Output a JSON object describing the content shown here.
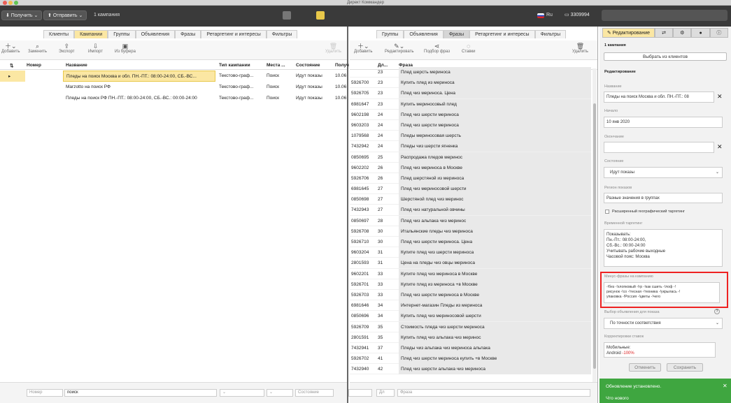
{
  "app": {
    "title": "Директ Коммандер"
  },
  "toolbar": {
    "get_label": "⬇ Получить ⌄",
    "send_label": "⬆ Отправить ⌄",
    "campaigns_count": "1 кампания",
    "balance": "3309994",
    "lang": "Ru"
  },
  "left": {
    "tabs": [
      "Клиенты",
      "Кампании",
      "Группы",
      "Объявления",
      "Фразы",
      "Ретаргетинг и интересы",
      "Фильтры"
    ],
    "active_tab": 1,
    "actions": [
      "Добавить",
      "Заменить",
      "Экспорт",
      "Импорт",
      "Из буфера"
    ],
    "delete_label": "Удалить",
    "columns": [
      "Номер",
      "Название",
      "Тип кампании",
      "Места ...",
      "Состояние",
      "Получ"
    ],
    "rows": [
      {
        "name": "Пледы на поиск Москва и обл. ПН.-ПТ.: 08:00-24:00, СБ.-ВС...",
        "type": "Текстово-граф...",
        "place": "Поиск",
        "state": "Идут показы",
        "extra": "10.06",
        "selected": true
      },
      {
        "name": "Marzotto на поиск РФ",
        "type": "Текстово-граф...",
        "place": "Поиск",
        "state": "Идут показы",
        "extra": "10.06",
        "selected": false
      },
      {
        "name": "Пледы на поиск РФ ПН.-ПТ.: 08:00-24:00, СБ.-ВС.: 00:00-24:00",
        "type": "Текстово-граф...",
        "place": "Поиск",
        "state": "Идут показы",
        "extra": "10.06",
        "selected": false
      }
    ],
    "filter_number_placeholder": "Номер",
    "filter_name_value": "поиск",
    "filter_state_placeholder": "Состояние"
  },
  "middle": {
    "tabs": [
      "Группы",
      "Объявления",
      "Фразы",
      "Ретаргетинг и интересы",
      "Фильтры"
    ],
    "active_tab": 2,
    "actions": [
      "Добавить",
      "Редактировать",
      "Подбор фраз",
      "Ставки"
    ],
    "delete_label": "Удалить",
    "columns": [
      "Дл...",
      "Фраза"
    ],
    "rows": [
      {
        "id": "",
        "len": "23",
        "phrase": "Плед шерсть мериноса"
      },
      {
        "id": "5926700",
        "len": "23",
        "phrase": "Купить плед из мериноса"
      },
      {
        "id": "5926705",
        "len": "23",
        "phrase": "Плед чиз мериноса. Цена"
      },
      {
        "id": "6981647",
        "len": "23",
        "phrase": "Купить мериносовый плед"
      },
      {
        "id": "9602198",
        "len": "24",
        "phrase": "Плед чиз шерсти мериноса"
      },
      {
        "id": "9603203",
        "len": "24",
        "phrase": "Плед чиз шерсти мериноса"
      },
      {
        "id": "1079568",
        "len": "24",
        "phrase": "Пледы мериносовая шерсть"
      },
      {
        "id": "7432942",
        "len": "24",
        "phrase": "Пледы чиз шерсти ягненка"
      },
      {
        "id": "0850695",
        "len": "25",
        "phrase": "Распродажа пледов меринос"
      },
      {
        "id": "9602202",
        "len": "26",
        "phrase": "Плед чиз мериноса в Москве"
      },
      {
        "id": "5926706",
        "len": "26",
        "phrase": "Плед шерстяной из мериноса"
      },
      {
        "id": "6981645",
        "len": "27",
        "phrase": "Плед чиз мериносовой шерсти"
      },
      {
        "id": "0850698",
        "len": "27",
        "phrase": "Шерстяной плед чиз меринос"
      },
      {
        "id": "7432943",
        "len": "27",
        "phrase": "Плед чиз натуральной овчины"
      },
      {
        "id": "0850697",
        "len": "28",
        "phrase": "Плед чиз альпака чиз меринос"
      },
      {
        "id": "5926708",
        "len": "30",
        "phrase": "Итальянские пледы чиз мериноса"
      },
      {
        "id": "5926710",
        "len": "30",
        "phrase": "Плед чиз шерсти мериноса. Цена"
      },
      {
        "id": "9603204",
        "len": "31",
        "phrase": "Купите плед чиз шерсти мериноса"
      },
      {
        "id": "2801593",
        "len": "31",
        "phrase": "Цена на пледы чиз овцы мериноса"
      },
      {
        "id": "9602201",
        "len": "33",
        "phrase": "Купите плед чиз мериноса в Москве"
      },
      {
        "id": "5926701",
        "len": "33",
        "phrase": "Купите плед из мериноса +в Москве"
      },
      {
        "id": "5926703",
        "len": "33",
        "phrase": "Плед чиз шерсти мериноса в Москве"
      },
      {
        "id": "6981646",
        "len": "34",
        "phrase": "Интернет-магазин Пледы из мериноса"
      },
      {
        "id": "0850696",
        "len": "34",
        "phrase": "Купить плед чиз мериносовой шерсти"
      },
      {
        "id": "5926709",
        "len": "35",
        "phrase": "Стоимость пледа чиз шерсти мериноса"
      },
      {
        "id": "2801591",
        "len": "35",
        "phrase": "Купить плед чиз альпака чиз меринос"
      },
      {
        "id": "7432941",
        "len": "37",
        "phrase": "Пледы чиз альпака чиз мериноса альпака"
      },
      {
        "id": "5926702",
        "len": "41",
        "phrase": "Плед чиз шерсти мериноса купить +в Москве"
      },
      {
        "id": "7432940",
        "len": "42",
        "phrase": "Плед чиз шерсти альпака чиз мериноса"
      }
    ],
    "filter_len_placeholder": "Дл",
    "filter_phrase_placeholder": "Фраза"
  },
  "right": {
    "edit_tab": "Редактирование",
    "campaigns_count": "1 кампания",
    "choose_client": "Выбрать из клиентов",
    "section": "Редактирование",
    "name_label": "Название",
    "name_value": "Пледы на поиск Москва и обл. ПН.-ПТ.: 08",
    "start_label": "Начало",
    "start_value": "10 янв 2020",
    "end_label": "Окончание",
    "state_label": "Состояние",
    "state_value": "Идут показы",
    "region_label": "Регион показов",
    "region_value": "Разные значения в группах",
    "geo_label": "Расширенный географический таргетинг",
    "time_label": "Временной таргетинг",
    "time_lines": [
      "Показывать:",
      "Пн.-Пт.: 08:00-24:00,",
      "Сб.-Вс.: 00:00-24:00",
      "Учитывать рабочие выходные",
      "Часовой пояс: Москва"
    ],
    "minus_label": "Минус-фразы на кампанию",
    "minus_lines": [
      "-!без -!хлопковый -!гр -!как сшить -!лоф -!",
      "рисунок -!со -!тесная -!техника -!укрылась -!",
      "упаковка -!Россия -!цветы -!чего"
    ],
    "ad_choice_label": "Выбор объявления для показа",
    "ad_choice_value": "По точности соответствия",
    "bid_label": "Корректировки ставок",
    "bid_line1": "Мобильные:",
    "bid_line2_prefix": "Android",
    "bid_line2_value": "-100%",
    "cancel_label": "Отменить",
    "save_label": "Сохранить"
  },
  "notice": {
    "title": "Обновление установлено.",
    "link": "Что нового"
  }
}
